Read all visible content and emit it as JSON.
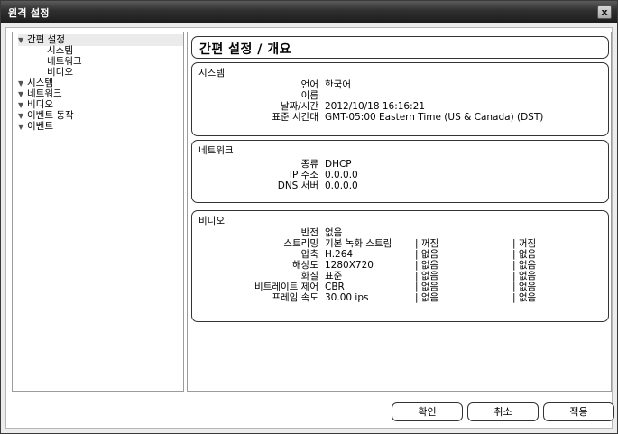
{
  "window": {
    "title": "원격 설정",
    "close_icon": "close-icon",
    "close_glyph": "x"
  },
  "tree": {
    "arrow_glyph": "▼",
    "items": [
      {
        "label": "간편 설정",
        "expanded": true
      },
      {
        "label": "시스템",
        "child": true
      },
      {
        "label": "네트워크",
        "child": true
      },
      {
        "label": "비디오",
        "child": true
      },
      {
        "label": "시스템",
        "expanded": true
      },
      {
        "label": "네트워크",
        "expanded": true
      },
      {
        "label": "비디오",
        "expanded": true
      },
      {
        "label": "이벤트 동작",
        "expanded": true
      },
      {
        "label": "이벤트",
        "expanded": true
      }
    ]
  },
  "main": {
    "heading": "간편 설정 / 개요",
    "system": {
      "title": "시스템",
      "rows": [
        {
          "label": "언어",
          "value": "한국어"
        },
        {
          "label": "이름",
          "value": ""
        },
        {
          "label": "날짜/시간",
          "value": "2012/10/18 16:16:21"
        },
        {
          "label": "표준 시간대",
          "value": "GMT-05:00 Eastern Time (US & Canada) (DST)"
        }
      ]
    },
    "network": {
      "title": "네트워크",
      "rows": [
        {
          "label": "종류",
          "value": "DHCP"
        },
        {
          "label": "IP 주소",
          "value": "0.0.0.0"
        },
        {
          "label": "DNS 서버",
          "value": "0.0.0.0"
        }
      ]
    },
    "video": {
      "title": "비디오",
      "rows": [
        {
          "label": "반전",
          "value": "없음",
          "col2": "",
          "col3": ""
        },
        {
          "label": "스트리밍",
          "value": "기본 녹화 스트림",
          "col2": "| 꺼짐",
          "col3": "| 꺼짐"
        },
        {
          "label": "압축",
          "value": "H.264",
          "col2": "| 없음",
          "col3": "| 없음"
        },
        {
          "label": "해상도",
          "value": "1280X720",
          "col2": "| 없음",
          "col3": "| 없음"
        },
        {
          "label": "화질",
          "value": "표준",
          "col2": "| 없음",
          "col3": "| 없음"
        },
        {
          "label": "비트레이트 제어",
          "value": "CBR",
          "col2": "| 없음",
          "col3": "| 없음"
        },
        {
          "label": "프레임 속도",
          "value": "30.00 ips",
          "col2": "| 없음",
          "col3": "| 없음"
        }
      ]
    }
  },
  "buttons": {
    "ok": "확인",
    "cancel": "취소",
    "apply": "적용"
  }
}
